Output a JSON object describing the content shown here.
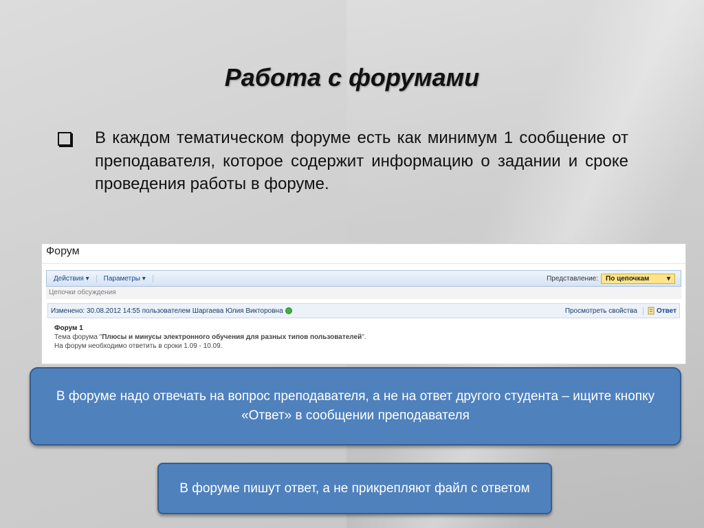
{
  "slide": {
    "title": "Работа с форумами",
    "bullet": "В каждом тематическом форуме есть как минимум 1 сообщение от преподавателя, которое содержит информацию о задании и  сроке проведения работы в форуме."
  },
  "screenshot": {
    "title": "Форум",
    "toolbar": {
      "actions": "Действия",
      "parameters": "Параметры",
      "view_label": "Представление:",
      "view_value": "По цепочкам"
    },
    "breadcrumb": "Цепочки обсуждения",
    "message": {
      "changed_prefix": "Изменено: 30.08.2012 14:55 пользователем",
      "author": "Шаргаева Юлия Викторовна",
      "view_properties": "Просмотреть свойства",
      "reply": "Ответ",
      "forum_name": "Форум 1",
      "topic_prefix": "Тема форума \"",
      "topic": "Плюсы и минусы электронного обучения для разных типов пользователей",
      "topic_suffix": "\".",
      "deadline": "На форум необходимо ответить в сроки 1.09 - 10.09."
    }
  },
  "callouts": {
    "first": "В форуме надо отвечать на вопрос преподавателя, а не на ответ другого студента – ищите кнопку «Ответ» в сообщении преподавателя",
    "second": "В форуме пишут ответ, а не прикрепляют файл с ответом"
  },
  "colors": {
    "callout_fill": "#4f81bd",
    "callout_border": "#385d8a",
    "view_select": "#ffe588"
  }
}
